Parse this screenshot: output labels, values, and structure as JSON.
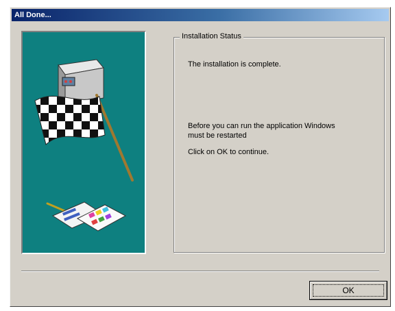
{
  "window": {
    "title": "All Done..."
  },
  "group": {
    "label": "Installation Status"
  },
  "messages": {
    "complete": "The installation is complete.",
    "restart_line1": "Before you can run the application Windows",
    "restart_line2": "must be restarted",
    "continue": "Click on OK to continue."
  },
  "buttons": {
    "ok_label": "OK"
  },
  "icons": {
    "illustration": "checkered-flag-computer-illustration"
  },
  "colors": {
    "title_start": "#0a246a",
    "title_end": "#a6caf0",
    "art_background": "#0e8080",
    "dialog_face": "#d4d0c8"
  }
}
